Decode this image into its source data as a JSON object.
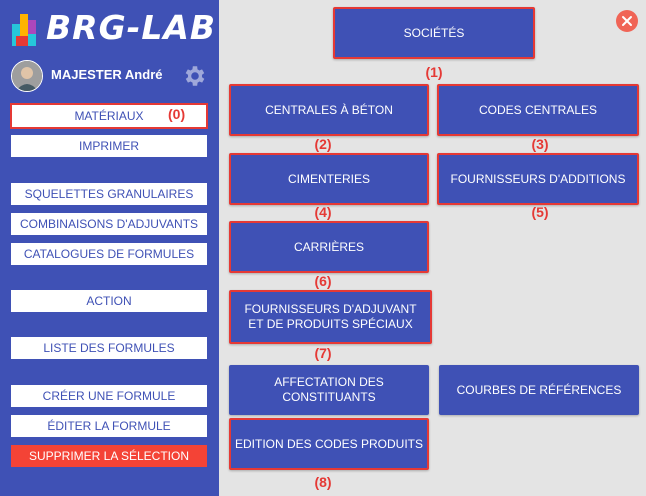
{
  "app": {
    "brand": "BRG-LAB"
  },
  "user": {
    "name": "MAJESTER André"
  },
  "colors": {
    "primary": "#3f51b5",
    "danger": "#f44336",
    "highlight": "#e53935",
    "background": "#e4e4e4"
  },
  "icons": {
    "logo": "brg-logo-icon",
    "settings": "gear-icon",
    "close": "close-icon"
  },
  "sidebar": {
    "materiaux": "MATÉRIAUX",
    "materiaux_tag": "(0)",
    "imprimer": "IMPRIMER",
    "squelettes": "SQUELETTES GRANULAIRES",
    "combinaisons": "COMBINAISONS D'ADJUVANTS",
    "catalogues": "CATALOGUES DE FORMULES",
    "action": "ACTION",
    "liste": "LISTE DES FORMULES",
    "creer": "CRÉER UNE FORMULE",
    "editer": "ÉDITER LA FORMULE",
    "supprimer": "SUPPRIMER LA SÉLECTION"
  },
  "main": {
    "societes": "SOCIÉTÉS",
    "societes_tag": "(1)",
    "centrales": "CENTRALES À BÉTON",
    "centrales_tag": "(2)",
    "codes_centrales": "CODES CENTRALES",
    "codes_centrales_tag": "(3)",
    "cimenteries": "CIMENTERIES",
    "cimenteries_tag": "(4)",
    "fournisseurs_additions": "FOURNISSEURS D'ADDITIONS",
    "fournisseurs_additions_tag": "(5)",
    "carrieres": "CARRIÈRES",
    "carrieres_tag": "(6)",
    "fournisseurs_adjuvant": "FOURNISSEURS D'ADJUVANT\nET DE PRODUITS SPÉCIAUX",
    "fournisseurs_adjuvant_tag": "(7)",
    "affectation": "AFFECTATION DES CONSTITUANTS",
    "courbes": "COURBES DE RÉFÉRENCES",
    "edition": "EDITION DES CODES PRODUITS",
    "edition_tag": "(8)"
  }
}
